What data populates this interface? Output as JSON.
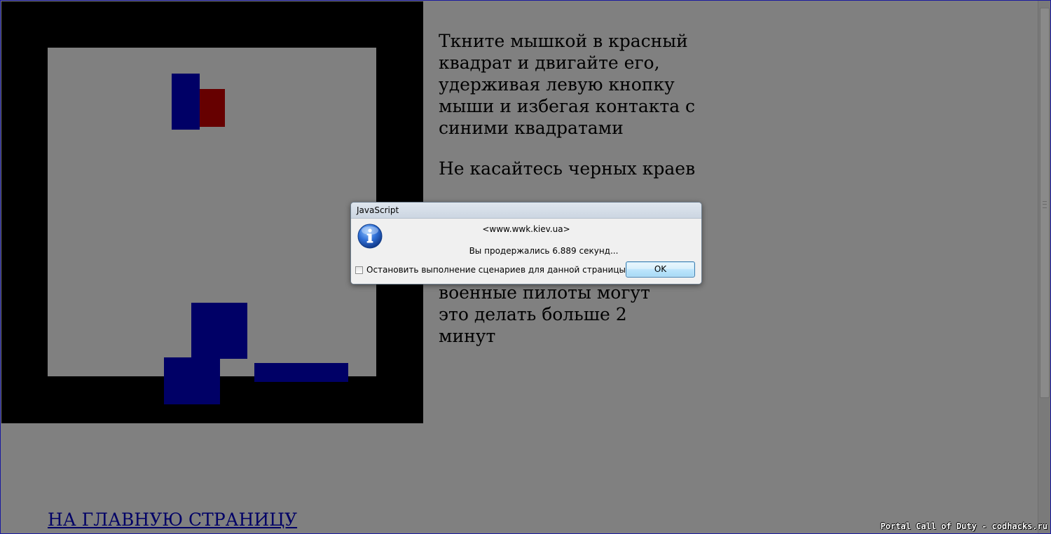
{
  "game": {
    "instructions": [
      "Ткните мышкой в красный квадрат и двигайте его, удерживая левую кнопку мыши и избегая контакта с синими квадратами",
      "Не касайтесь черных краев"
    ],
    "note": "военные пилоты могут это делать больше 2 минут",
    "home_link": "НА ГЛАВНУЮ СТРАНИЦУ",
    "colors": {
      "border": "#000000",
      "field": "#808080",
      "enemy": "#000066",
      "player": "#660000"
    }
  },
  "dialog": {
    "title": "JavaScript",
    "icon": "info-icon",
    "origin": "<www.wwk.kiev.ua>",
    "message": "Вы продержались 6.889 секунд...",
    "checkbox_label": "Остановить выполнение сценариев для данной страницы",
    "checkbox_checked": false,
    "ok_label": "OK"
  },
  "watermark": "Portal Call of Duty - codhacks.ru"
}
